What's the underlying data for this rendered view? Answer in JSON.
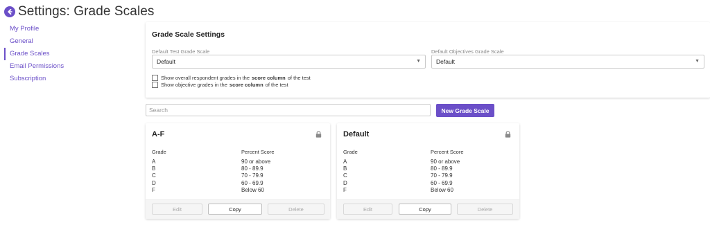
{
  "header": {
    "title_prefix": "Settings:",
    "title_rest": " Grade Scales",
    "back_icon": "arrow-left-circle-icon"
  },
  "sidebar": {
    "items": [
      {
        "label": "My Profile",
        "active": false
      },
      {
        "label": "General",
        "active": false
      },
      {
        "label": "Grade Scales",
        "active": true
      },
      {
        "label": "Email Permissions",
        "active": false
      },
      {
        "label": "Subscription",
        "active": false
      }
    ]
  },
  "settings": {
    "title": "Grade Scale Settings",
    "default_test_label": "Default Test Grade Scale",
    "default_test_value": "Default",
    "default_objectives_label": "Default Objectives Grade Scale",
    "default_objectives_value": "Default",
    "check1_pre": "Show overall respondent grades in the",
    "check1_bold": "score column",
    "check1_post": "of the test",
    "check1_checked": false,
    "check2_pre": "Show objective grades in the",
    "check2_bold": "score column",
    "check2_post": "of the test",
    "check2_checked": false
  },
  "search": {
    "placeholder": "Search",
    "value": ""
  },
  "new_button_label": "New Grade Scale",
  "accent_color": "#6b4fc8",
  "cards": [
    {
      "title": "A-F",
      "locked": true,
      "col_grade": "Grade",
      "col_percent": "Percent Score",
      "rows": [
        {
          "grade": "A",
          "percent": "90 or above"
        },
        {
          "grade": "B",
          "percent": "80 - 89.9"
        },
        {
          "grade": "C",
          "percent": "70 - 79.9"
        },
        {
          "grade": "D",
          "percent": "60 - 69.9"
        },
        {
          "grade": "F",
          "percent": "Below 60"
        }
      ],
      "edit_label": "Edit",
      "copy_label": "Copy",
      "delete_label": "Delete"
    },
    {
      "title": "Default",
      "locked": true,
      "col_grade": "Grade",
      "col_percent": "Percent Score",
      "rows": [
        {
          "grade": "A",
          "percent": "90 or above"
        },
        {
          "grade": "B",
          "percent": "80 - 89.9"
        },
        {
          "grade": "C",
          "percent": "70 - 79.9"
        },
        {
          "grade": "D",
          "percent": "60 - 69.9"
        },
        {
          "grade": "F",
          "percent": "Below 60"
        }
      ],
      "edit_label": "Edit",
      "copy_label": "Copy",
      "delete_label": "Delete"
    }
  ]
}
